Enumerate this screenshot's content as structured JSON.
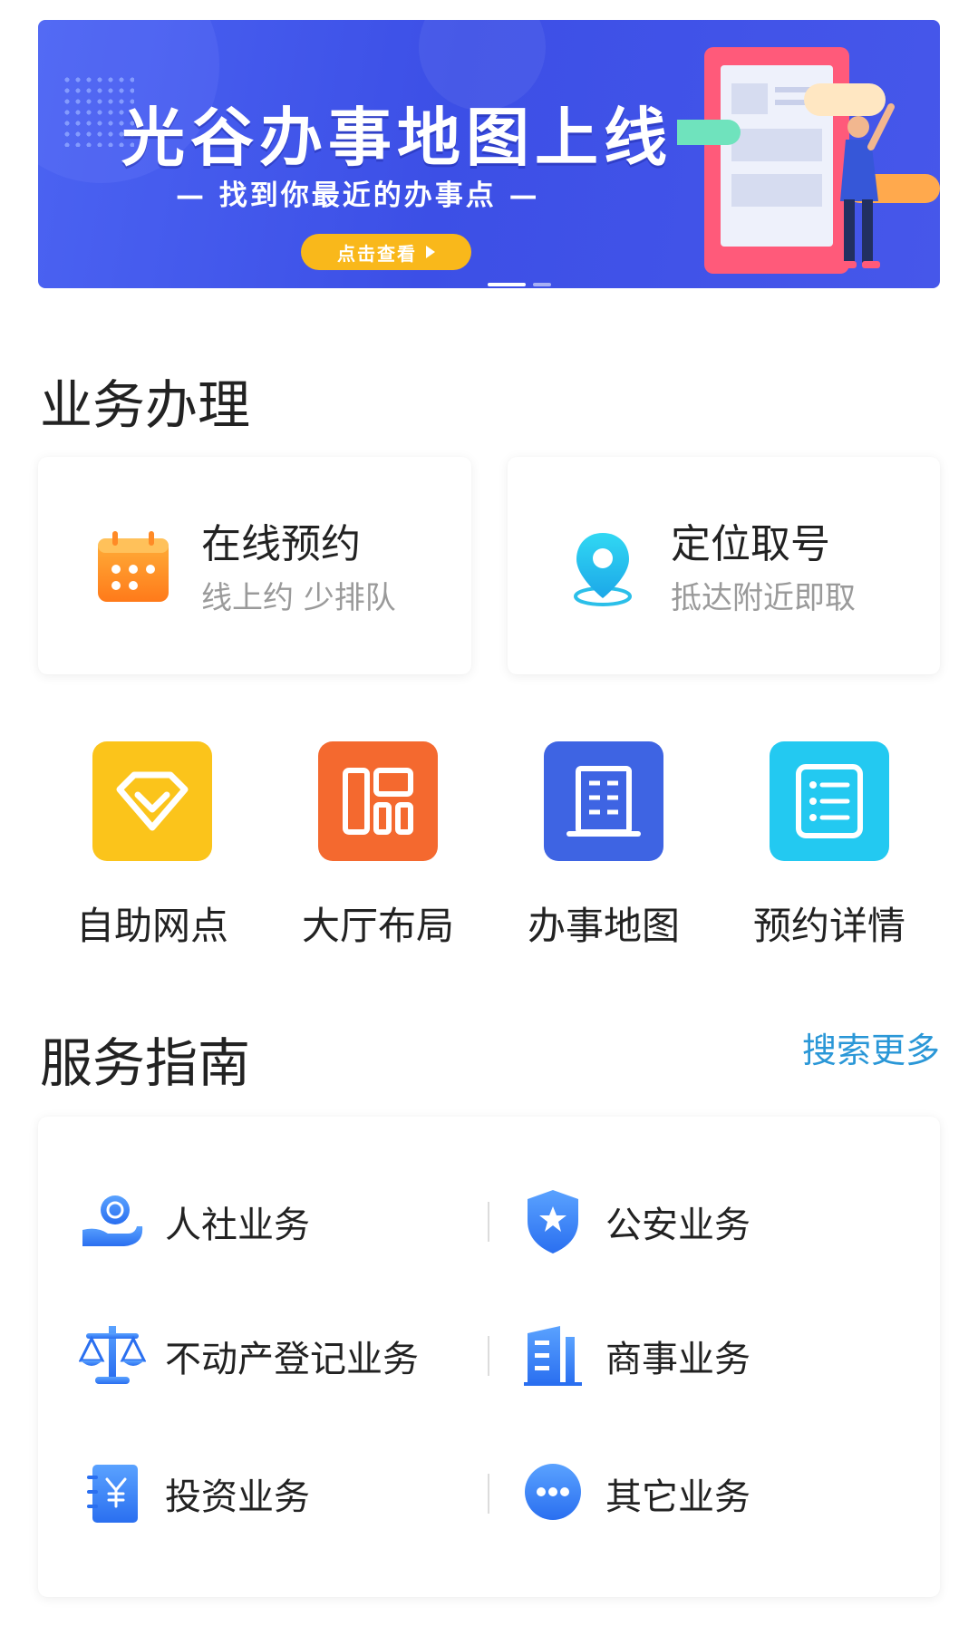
{
  "banner": {
    "title": "光谷办事地图上线",
    "subtitle": "— 找到你最近的办事点 —",
    "button_label": "点击查看"
  },
  "business": {
    "title": "业务办理",
    "cards": [
      {
        "title": "在线预约",
        "subtitle": "线上约 少排队",
        "icon": "calendar-icon"
      },
      {
        "title": "定位取号",
        "subtitle": "抵达附近即取",
        "icon": "location-pin-icon"
      }
    ],
    "quick": [
      {
        "label": "自助网点",
        "icon": "diamond-icon",
        "color": "#fbc41b"
      },
      {
        "label": "大厅布局",
        "icon": "layout-icon",
        "color": "#f4692f"
      },
      {
        "label": "办事地图",
        "icon": "building-icon",
        "color": "#3e64e3"
      },
      {
        "label": "预约详情",
        "icon": "list-icon",
        "color": "#23c9f1"
      }
    ]
  },
  "guide": {
    "title": "服务指南",
    "more": "搜索更多",
    "items": [
      {
        "label": "人社业务",
        "icon": "hand-coin-icon"
      },
      {
        "label": "公安业务",
        "icon": "police-shield-icon"
      },
      {
        "label": "不动产登记业务",
        "icon": "scale-icon"
      },
      {
        "label": "商事业务",
        "icon": "building-bars-icon"
      },
      {
        "label": "投资业务",
        "icon": "yuan-notebook-icon"
      },
      {
        "label": "其它业务",
        "icon": "more-dots-icon"
      }
    ]
  },
  "colors": {
    "banner": "#4055e8",
    "accent_link": "#2a97d7",
    "icon_blue": "#3b82f6"
  }
}
